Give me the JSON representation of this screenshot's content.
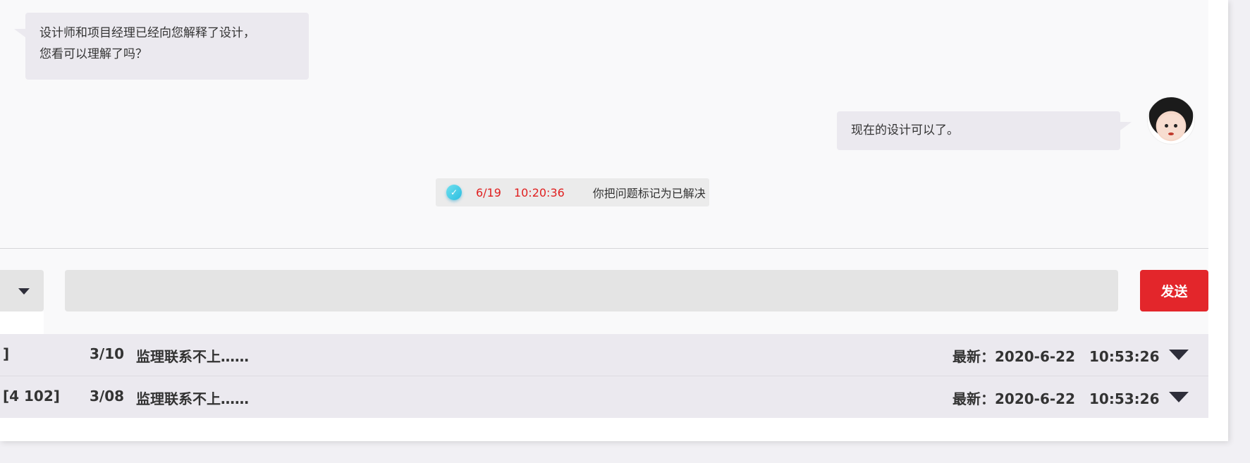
{
  "chat": {
    "incoming_message": {
      "line1": "设计师和项目经理已经向您解释了设计，",
      "line2": "您看可以理解了吗？"
    },
    "outgoing_message": "现在的设计可以了。",
    "status": {
      "icon": "check-circle-icon",
      "date": "6/19",
      "time": "10:20:36",
      "text": "你把问题标记为已解决"
    }
  },
  "composer": {
    "input_value": "",
    "input_placeholder": "",
    "send_label": "发送",
    "dropdown_icon": "chevron-down-icon"
  },
  "issues": [
    {
      "code": "]",
      "date": "3/10",
      "title": "监理联系不上……",
      "latest": "最新：2020-6-22　10:53:26"
    },
    {
      "code": "[4 102]",
      "date": "3/08",
      "title": "监理联系不上……",
      "latest": "最新：2020-6-22　10:53:26"
    }
  ],
  "colors": {
    "accent_red": "#e3262b",
    "status_red": "#e02020",
    "bubble_bg": "#ebe9ef",
    "input_bg": "#e4e4e4"
  }
}
